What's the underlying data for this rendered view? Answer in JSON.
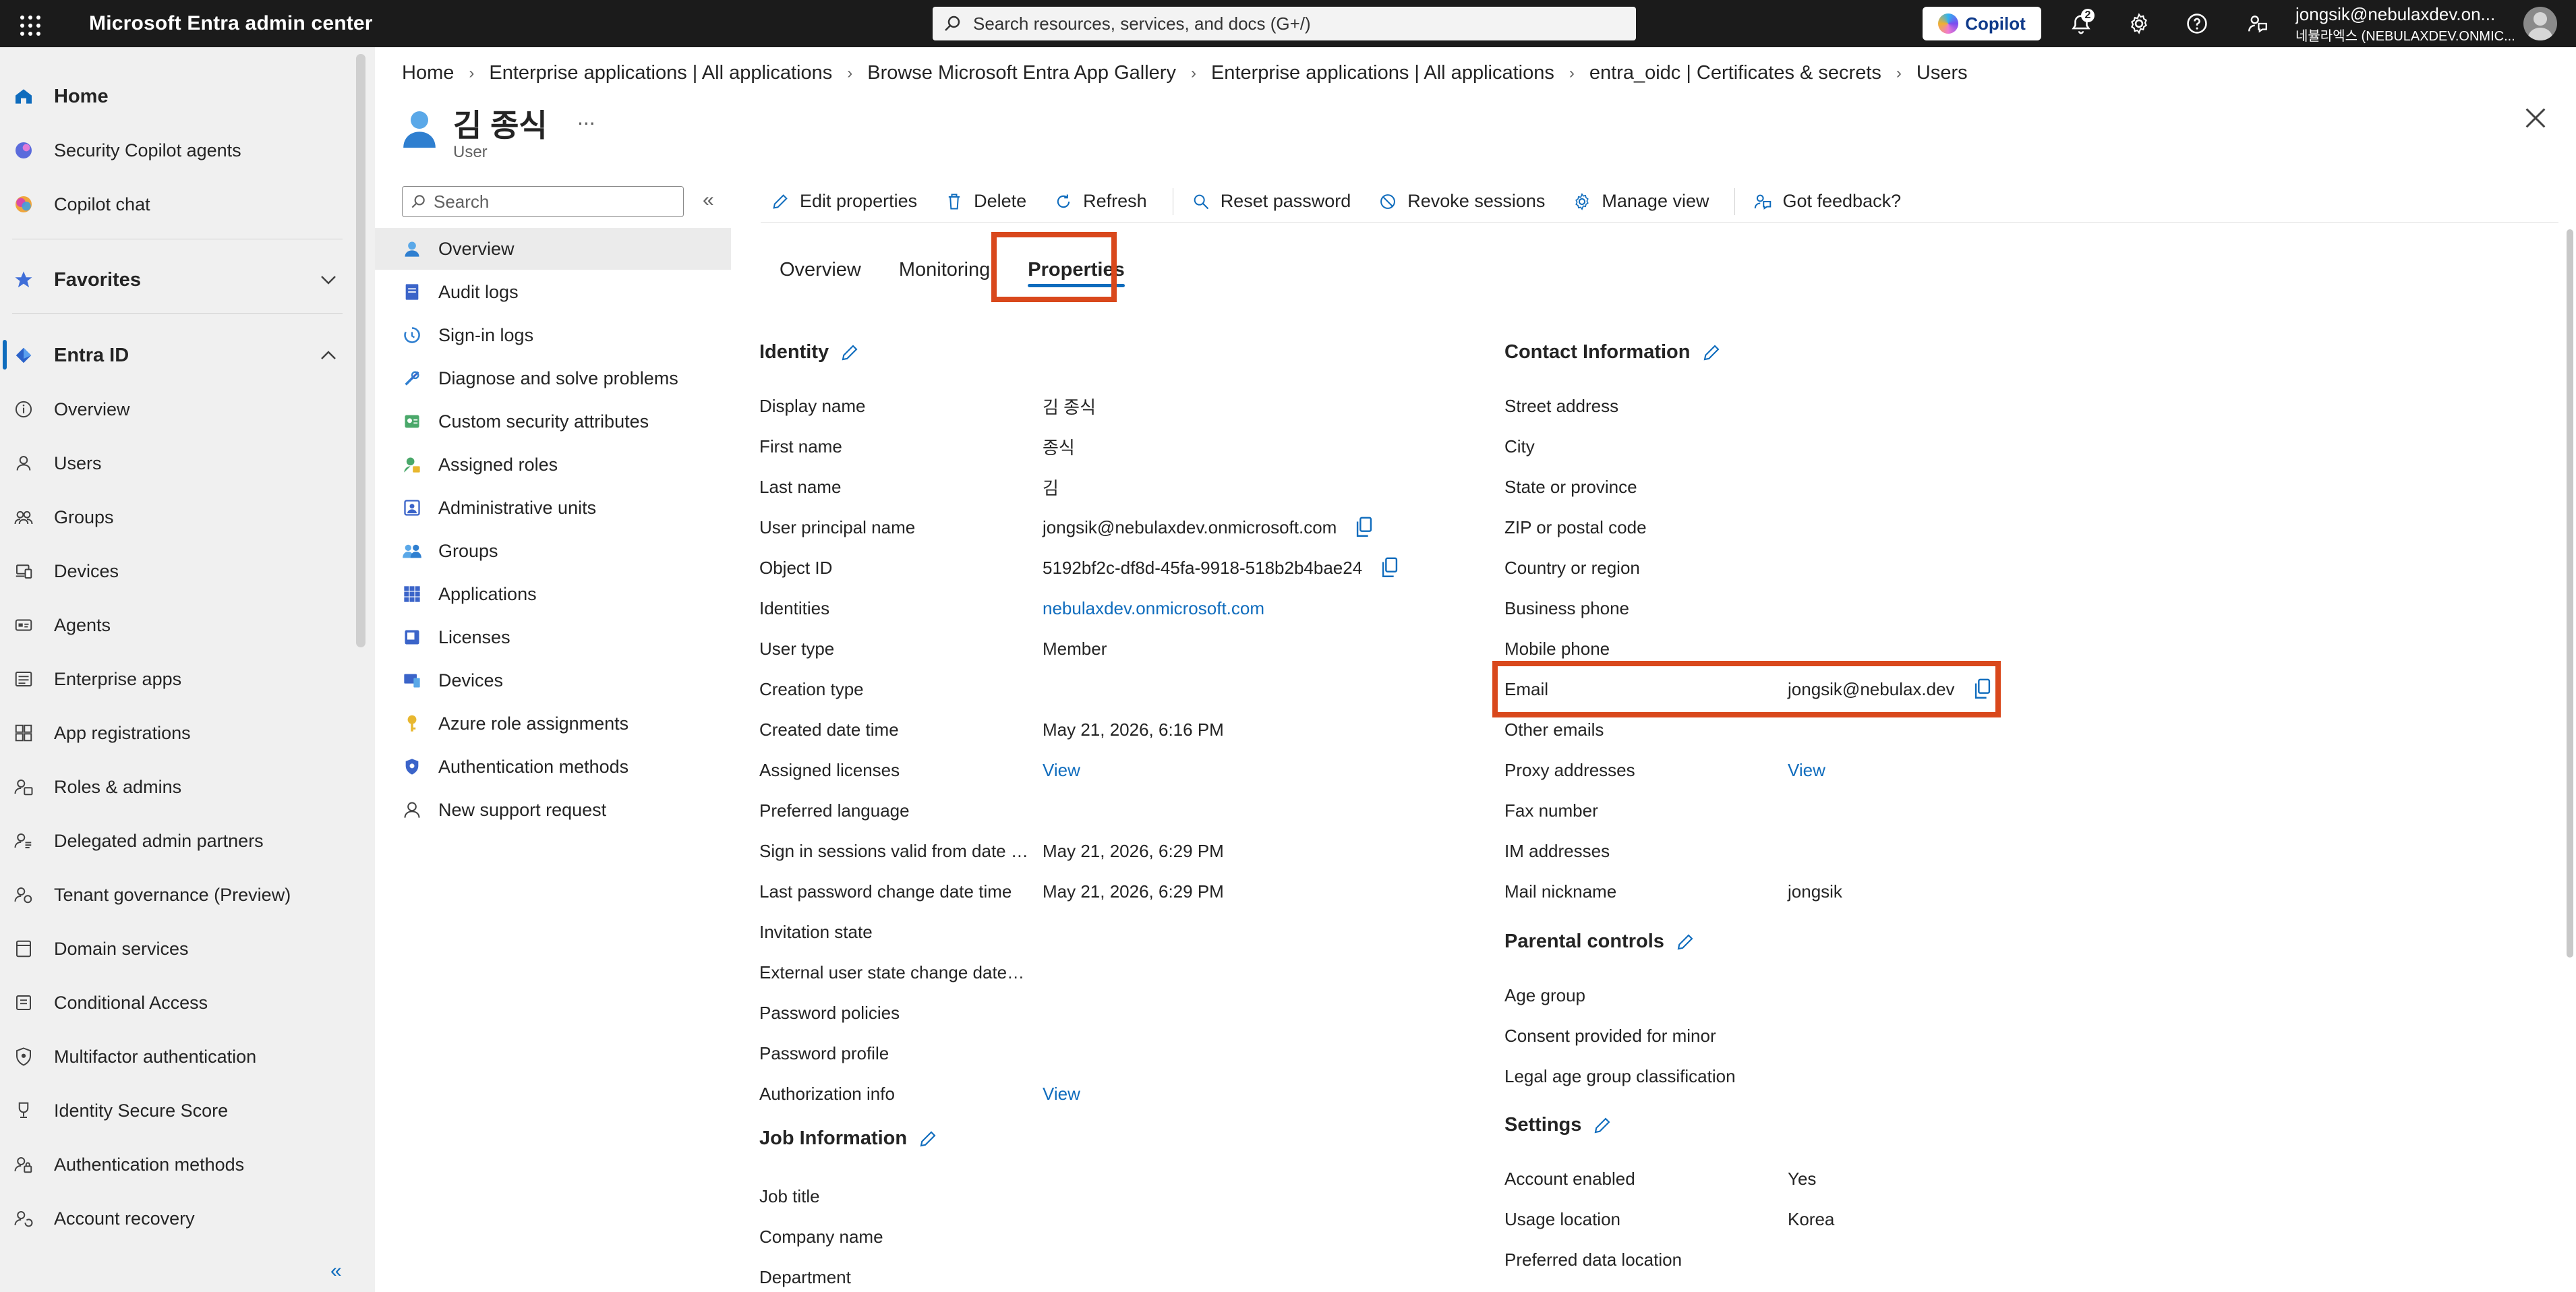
{
  "topbar": {
    "app_title": "Microsoft Entra admin center",
    "search_placeholder": "Search resources, services, and docs (G+/)",
    "copilot_label": "Copilot",
    "notification_count": "2",
    "account_email": "jongsik@nebulaxdev.on...",
    "account_tenant": "네뷸라엑스 (NEBULAXDEV.ONMIC..."
  },
  "leftnav": {
    "items": [
      {
        "label": "Home",
        "icon": "home-icon"
      },
      {
        "label": "Security Copilot agents",
        "icon": "security-copilot-icon"
      },
      {
        "label": "Copilot chat",
        "icon": "copilot-icon"
      },
      {
        "label": "Favorites",
        "icon": "star-icon"
      },
      {
        "label": "Entra ID",
        "icon": "entra-icon"
      },
      {
        "label": "Overview",
        "icon": "info-icon"
      },
      {
        "label": "Users",
        "icon": "person-icon"
      },
      {
        "label": "Groups",
        "icon": "people-icon"
      },
      {
        "label": "Devices",
        "icon": "devices-icon"
      },
      {
        "label": "Agents",
        "icon": "agent-icon"
      },
      {
        "label": "Enterprise apps",
        "icon": "apps-icon"
      },
      {
        "label": "App registrations",
        "icon": "app-registration-icon"
      },
      {
        "label": "Roles & admins",
        "icon": "roles-icon"
      },
      {
        "label": "Delegated admin partners",
        "icon": "partners-icon"
      },
      {
        "label": "Tenant governance (Preview)",
        "icon": "governance-icon"
      },
      {
        "label": "Domain services",
        "icon": "domain-icon"
      },
      {
        "label": "Conditional Access",
        "icon": "conditional-access-icon"
      },
      {
        "label": "Multifactor authentication",
        "icon": "mfa-icon"
      },
      {
        "label": "Identity Secure Score",
        "icon": "trophy-icon"
      },
      {
        "label": "Authentication methods",
        "icon": "auth-methods-icon"
      },
      {
        "label": "Account recovery",
        "icon": "account-recovery-icon"
      }
    ]
  },
  "breadcrumb": [
    "Home",
    "Enterprise applications | All applications",
    "Browse Microsoft Entra App Gallery",
    "Enterprise applications | All applications",
    "entra_oidc | Certificates & secrets",
    "Users"
  ],
  "page": {
    "title": "김 종식",
    "more": "...",
    "subtitle": "User"
  },
  "resource_menu": {
    "search_placeholder": "Search",
    "items": [
      {
        "label": "Overview",
        "icon": "user-overview-icon"
      },
      {
        "label": "Audit logs",
        "icon": "audit-log-icon"
      },
      {
        "label": "Sign-in logs",
        "icon": "sign-in-log-icon"
      },
      {
        "label": "Diagnose and solve problems",
        "icon": "wrench-icon"
      },
      {
        "label": "Custom security attributes",
        "icon": "custom-attributes-icon"
      },
      {
        "label": "Assigned roles",
        "icon": "assigned-roles-icon"
      },
      {
        "label": "Administrative units",
        "icon": "admin-units-icon"
      },
      {
        "label": "Groups",
        "icon": "groups-icon"
      },
      {
        "label": "Applications",
        "icon": "applications-grid-icon"
      },
      {
        "label": "Licenses",
        "icon": "licenses-icon"
      },
      {
        "label": "Devices",
        "icon": "device-icon"
      },
      {
        "label": "Azure role assignments",
        "icon": "key-icon"
      },
      {
        "label": "Authentication methods",
        "icon": "shield-icon"
      },
      {
        "label": "New support request",
        "icon": "support-person-icon"
      }
    ]
  },
  "commands": {
    "edit": "Edit properties",
    "delete": "Delete",
    "refresh": "Refresh",
    "reset_password": "Reset password",
    "revoke_sessions": "Revoke sessions",
    "manage_view": "Manage view",
    "feedback": "Got feedback?"
  },
  "tabs": [
    "Overview",
    "Monitoring",
    "Properties"
  ],
  "identity": {
    "heading": "Identity",
    "rows": [
      {
        "label": "Display name",
        "value": "김 종식"
      },
      {
        "label": "First name",
        "value": "종식"
      },
      {
        "label": "Last name",
        "value": "김"
      },
      {
        "label": "User principal name",
        "value": "jongsik@nebulaxdev.onmicrosoft.com"
      },
      {
        "label": "Object ID",
        "value": "5192bf2c-df8d-45fa-9918-518b2b4bae24"
      },
      {
        "label": "Identities",
        "value": "nebulaxdev.onmicrosoft.com"
      },
      {
        "label": "User type",
        "value": "Member"
      },
      {
        "label": "Creation type",
        "value": ""
      },
      {
        "label": "Created date time",
        "value": "May 21, 2026, 6:16 PM"
      },
      {
        "label": "Assigned licenses",
        "value": "View"
      },
      {
        "label": "Preferred language",
        "value": ""
      },
      {
        "label": "Sign in sessions valid from date t...",
        "value": "May 21, 2026, 6:29 PM"
      },
      {
        "label": "Last password change date time",
        "value": "May 21, 2026, 6:29 PM"
      },
      {
        "label": "Invitation state",
        "value": ""
      },
      {
        "label": "External user state change date ti...",
        "value": ""
      },
      {
        "label": "Password policies",
        "value": ""
      },
      {
        "label": "Password profile",
        "value": ""
      },
      {
        "label": "Authorization info",
        "value": "View"
      }
    ]
  },
  "job": {
    "heading": "Job Information",
    "rows": [
      {
        "label": "Job title",
        "value": ""
      },
      {
        "label": "Company name",
        "value": ""
      },
      {
        "label": "Department",
        "value": ""
      }
    ]
  },
  "contact": {
    "heading": "Contact Information",
    "rows": [
      {
        "label": "Street address",
        "value": ""
      },
      {
        "label": "City",
        "value": ""
      },
      {
        "label": "State or province",
        "value": ""
      },
      {
        "label": "ZIP or postal code",
        "value": ""
      },
      {
        "label": "Country or region",
        "value": ""
      },
      {
        "label": "Business phone",
        "value": ""
      },
      {
        "label": "Mobile phone",
        "value": ""
      },
      {
        "label": "Email",
        "value": "jongsik@nebulax.dev"
      },
      {
        "label": "Other emails",
        "value": ""
      },
      {
        "label": "Proxy addresses",
        "value": "View"
      },
      {
        "label": "Fax number",
        "value": ""
      },
      {
        "label": "IM addresses",
        "value": ""
      },
      {
        "label": "Mail nickname",
        "value": "jongsik"
      }
    ]
  },
  "parental": {
    "heading": "Parental controls",
    "rows": [
      {
        "label": "Age group",
        "value": ""
      },
      {
        "label": "Consent provided for minor",
        "value": ""
      },
      {
        "label": "Legal age group classification",
        "value": ""
      }
    ]
  },
  "settings": {
    "heading": "Settings",
    "rows": [
      {
        "label": "Account enabled",
        "value": "Yes"
      },
      {
        "label": "Usage location",
        "value": "Korea"
      },
      {
        "label": "Preferred data location",
        "value": ""
      }
    ]
  },
  "colors": {
    "accent": "#0f6cbd",
    "highlight": "#d9481c",
    "topbar": "#1b1b1b",
    "nav_bg": "#f0f0f0"
  }
}
